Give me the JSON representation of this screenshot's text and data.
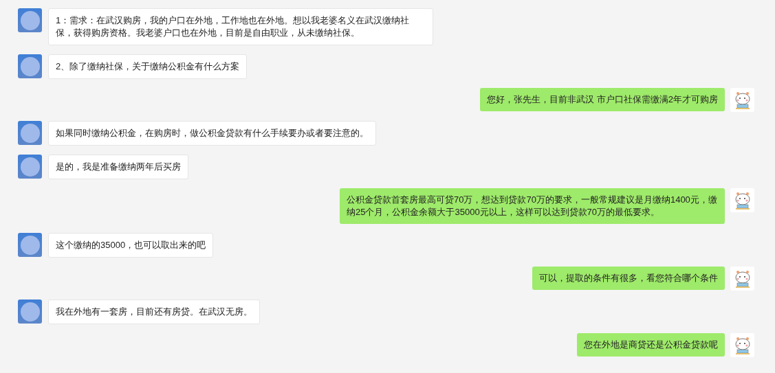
{
  "messages": [
    {
      "kind": "incoming",
      "text": "1：需求：在武汉购房，我的户口在外地，工作地也在外地。想以我老婆名义在武汉缴纳社保，获得购房资格。我老婆户口也在外地，目前是自由职业，从未缴纳社保。"
    },
    {
      "kind": "incoming",
      "text": "2、除了缴纳社保，关于缴纳公积金有什么方案"
    },
    {
      "kind": "outgoing",
      "text": "您好，张先生，目前非武汉 市户口社保需缴满2年才可购房"
    },
    {
      "kind": "incoming",
      "text": "如果同时缴纳公积金，在购房时，做公积金贷款有什么手续要办或者要注意的。"
    },
    {
      "kind": "incoming",
      "text": "是的，我是准备缴纳两年后买房"
    },
    {
      "kind": "outgoing",
      "text": "公积金贷款首套房最高可贷70万，想达到贷款70万的要求，一般常规建议是月缴纳1400元，缴纳25个月，公积金余额大于35000元以上，这样可以达到贷款70万的最低要求。"
    },
    {
      "kind": "incoming",
      "text": "这个缴纳的35000，也可以取出来的吧"
    },
    {
      "kind": "outgoing",
      "text": "可以，提取的条件有很多，看您符合哪个条件"
    },
    {
      "kind": "incoming",
      "text": "我在外地有一套房，目前还有房贷。在武汉无房。"
    },
    {
      "kind": "outgoing",
      "text": "您在外地是商贷还是公积金贷款呢"
    }
  ]
}
